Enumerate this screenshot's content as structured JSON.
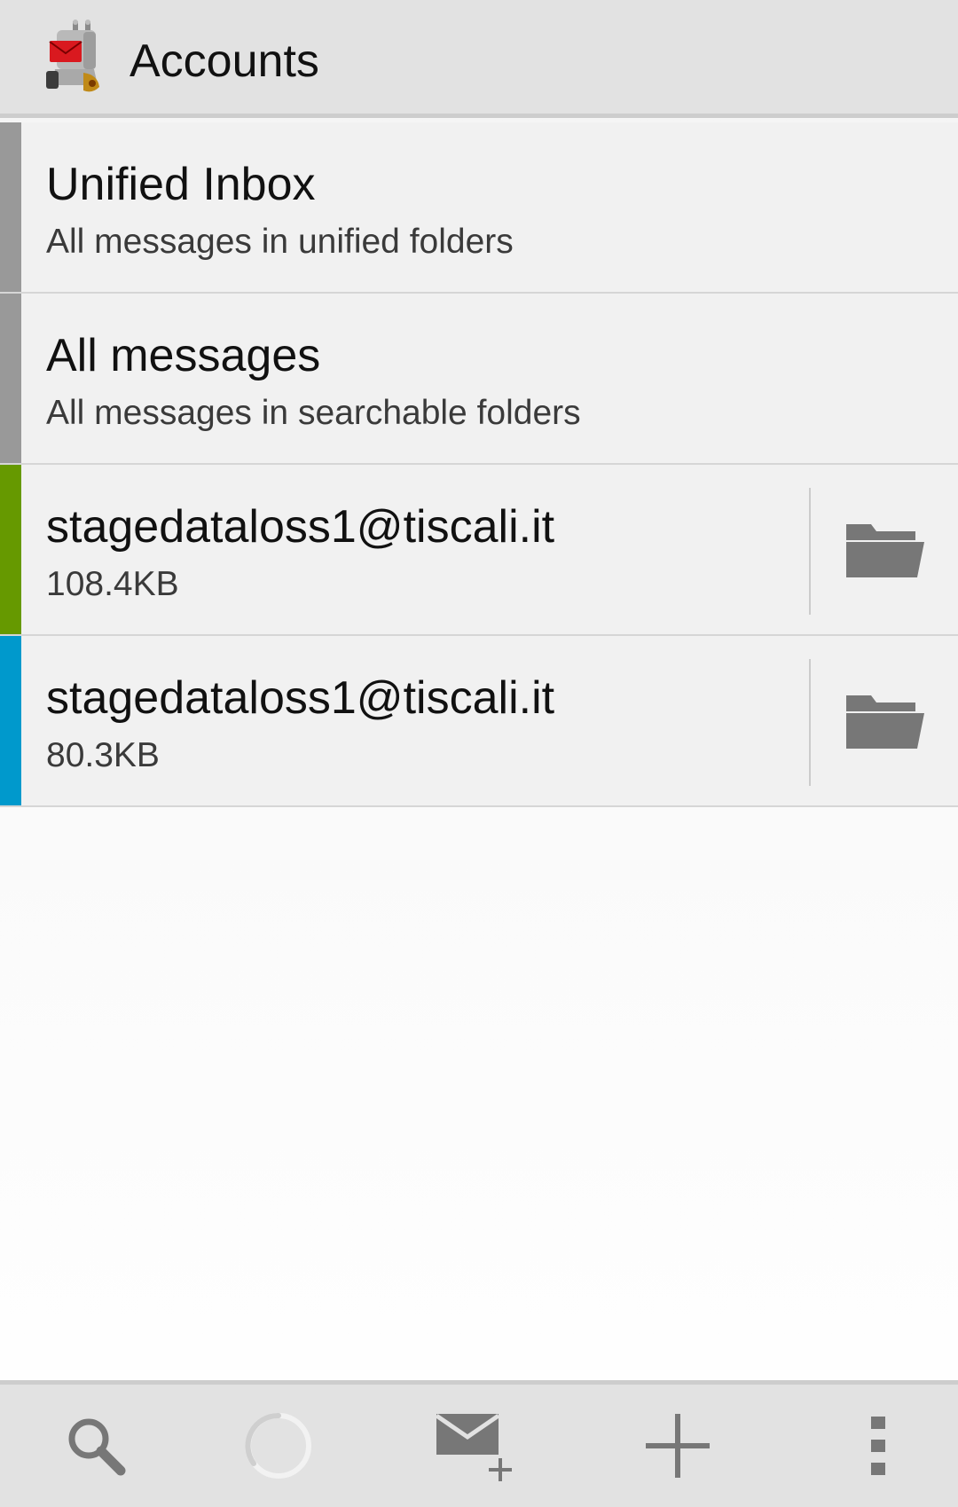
{
  "header": {
    "title": "Accounts",
    "app_icon": "k9-mail-dog-icon"
  },
  "accounts": [
    {
      "title": "Unified Inbox",
      "subtitle": "All messages in unified folders",
      "color": "#999999",
      "has_folder_button": false
    },
    {
      "title": "All messages",
      "subtitle": "All messages in searchable folders",
      "color": "#999999",
      "has_folder_button": false
    },
    {
      "title": "stagedataloss1@tiscali.it",
      "subtitle": "108.4KB",
      "color": "#669900",
      "has_folder_button": true,
      "folder_icon": "folder-icon"
    },
    {
      "title": "stagedataloss1@tiscali.it",
      "subtitle": "80.3KB",
      "color": "#0099cc",
      "has_folder_button": true,
      "folder_icon": "folder-icon"
    }
  ],
  "bottom_bar": {
    "buttons": [
      {
        "icon": "search-icon"
      },
      {
        "icon": "loading-spinner-icon"
      },
      {
        "icon": "compose-mail-icon"
      },
      {
        "icon": "add-account-icon"
      },
      {
        "icon": "overflow-menu-icon"
      }
    ]
  },
  "colors": {
    "action_bar": "#e2e2e2",
    "icon_gray": "#777777"
  }
}
